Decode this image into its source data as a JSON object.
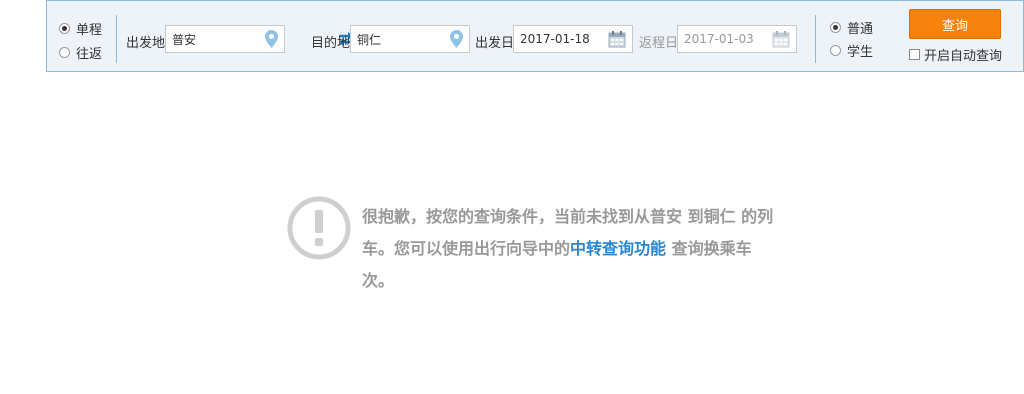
{
  "trip_type": {
    "one_way": "单程",
    "round_trip": "往返",
    "selected": "one_way"
  },
  "route": {
    "from_label": "出发地",
    "from_value": "普安",
    "to_label": "目的地",
    "to_value": "铜仁",
    "depart_label": "出发日",
    "depart_value": "2017-01-18",
    "return_label": "返程日",
    "return_value": "2017-01-03"
  },
  "ticket_type": {
    "normal": "普通",
    "student": "学生",
    "selected": "normal"
  },
  "actions": {
    "query_label": "查询",
    "auto_query_label": "开启自动查询",
    "auto_query_checked": false
  },
  "notice": {
    "text_before": "很抱歉，按您的查询条件，当前未找到从普安 到铜仁 的列车。您可以使用出行向导中的",
    "link_text": "中转查询功能",
    "text_after": " 查询换乘车次。"
  },
  "colors": {
    "bar_bg": "#eef3fa",
    "bar_border": "#8fb8de",
    "query_button": "#f7830f",
    "link": "#2a86cf",
    "muted_text": "#999999"
  },
  "icons": [
    "location-pin-icon",
    "swap-arrows-icon",
    "calendar-icon",
    "exclamation-circle-icon"
  ]
}
